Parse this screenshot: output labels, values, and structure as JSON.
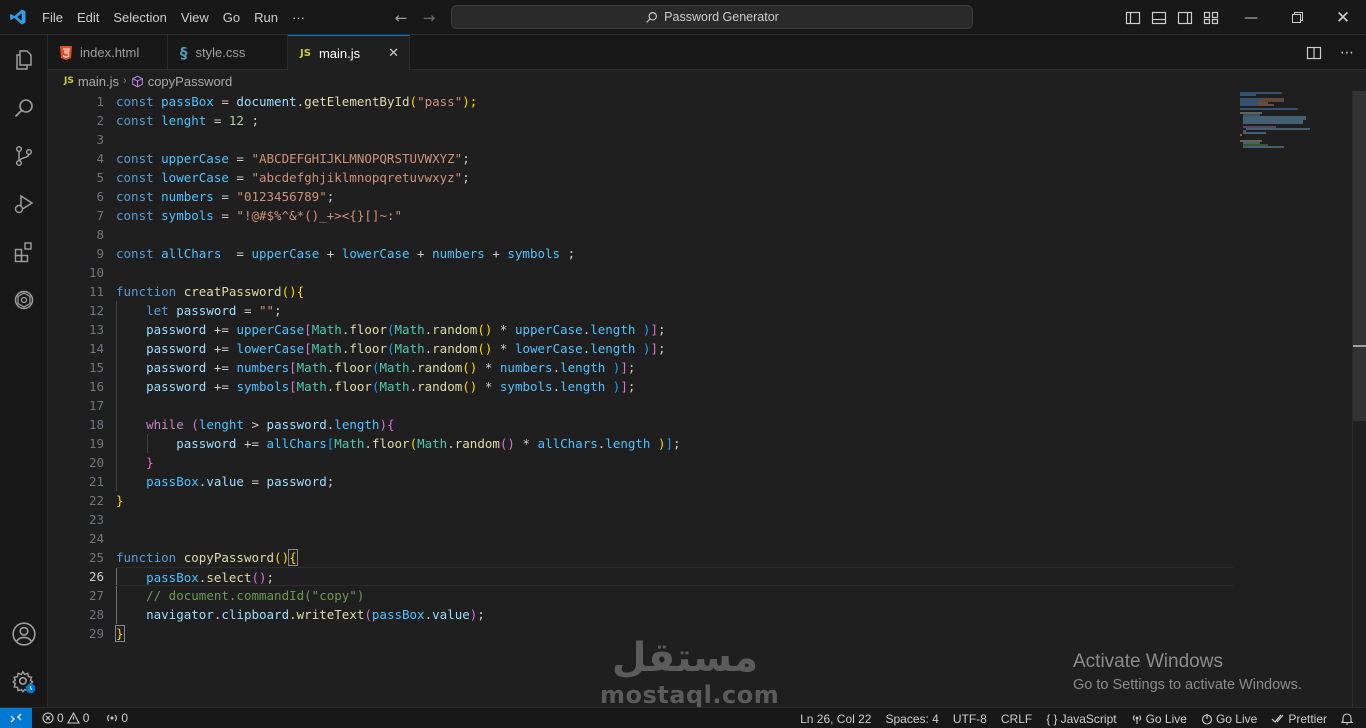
{
  "menu": [
    "File",
    "Edit",
    "Selection",
    "View",
    "Go",
    "Run",
    "···"
  ],
  "command_center": "Password Generator",
  "tabs": [
    {
      "label": "index.html",
      "icon": "html5-icon"
    },
    {
      "label": "style.css",
      "icon": "css-icon"
    },
    {
      "label": "main.js",
      "icon": "js-icon",
      "active": true
    }
  ],
  "js_badge": "JS",
  "breadcrumb": {
    "file": "main.js",
    "symbol": "copyPassword"
  },
  "line_numbers": [
    "1",
    "2",
    "3",
    "4",
    "5",
    "6",
    "7",
    "8",
    "9",
    "10",
    "11",
    "12",
    "13",
    "14",
    "15",
    "16",
    "17",
    "18",
    "19",
    "20",
    "21",
    "22",
    "23",
    "24",
    "25",
    "26",
    "27",
    "28",
    "29"
  ],
  "current_line": 26,
  "code": {
    "l1": [
      "const ",
      "passBox",
      " = ",
      "document",
      ".",
      "getElementById",
      "(",
      "\"pass\"",
      ");"
    ],
    "l2": [
      "const ",
      "lenght",
      " = ",
      "12",
      " ;"
    ],
    "l4": [
      "const ",
      "upperCase",
      " = ",
      "\"ABCDEFGHIJKLMNOPQRSTUVWXYZ\"",
      ";"
    ],
    "l5": [
      "const ",
      "lowerCase",
      " = ",
      "\"abcdefghjiklmnopqretuvwxyz\"",
      ";"
    ],
    "l6": [
      "const ",
      "numbers",
      " = ",
      "\"0123456789\"",
      ";"
    ],
    "l7": [
      "const ",
      "symbols",
      " = ",
      "\"!@#$%^&*()_+><{}[]~:\""
    ],
    "l9": [
      "const ",
      "allChars",
      "  = ",
      "upperCase",
      " + ",
      "lowerCase",
      " + ",
      "numbers",
      " + ",
      "symbols",
      " ;"
    ],
    "l11": [
      "function ",
      "creatPassword",
      "(){"
    ],
    "l12": [
      "    ",
      "let ",
      "password",
      " = ",
      "\"\"",
      ";"
    ],
    "l13": [
      "    ",
      "password",
      " += ",
      "upperCase",
      "[",
      "Math",
      ".",
      "floor",
      "(",
      "Math",
      ".",
      "random",
      "()",
      " * ",
      "upperCase",
      ".",
      "length",
      " )",
      "]",
      ";"
    ],
    "l14": [
      "    ",
      "password",
      " += ",
      "lowerCase",
      "[",
      "Math",
      ".",
      "floor",
      "(",
      "Math",
      ".",
      "random",
      "()",
      " * ",
      "lowerCase",
      ".",
      "length",
      " )",
      "]",
      ";"
    ],
    "l15": [
      "    ",
      "password",
      " += ",
      "numbers",
      "[",
      "Math",
      ".",
      "floor",
      "(",
      "Math",
      ".",
      "random",
      "()",
      " * ",
      "numbers",
      ".",
      "length",
      " )",
      "]",
      ";"
    ],
    "l16": [
      "    ",
      "password",
      " += ",
      "symbols",
      "[",
      "Math",
      ".",
      "floor",
      "(",
      "Math",
      ".",
      "random",
      "()",
      " * ",
      "symbols",
      ".",
      "length",
      " )",
      "]",
      ";"
    ],
    "l18": [
      "    ",
      "while",
      " (",
      "lenght",
      " > ",
      "password",
      ".",
      "length",
      "){"
    ],
    "l19": [
      "        ",
      "password",
      " += ",
      "allChars",
      "[",
      "Math",
      ".",
      "floor",
      "(",
      "Math",
      ".",
      "random",
      "()",
      " * ",
      "allChars",
      ".",
      "length",
      " )",
      "]",
      ";"
    ],
    "l20": [
      "    ",
      "}"
    ],
    "l21": [
      "    ",
      "passBox",
      ".",
      "value",
      " = ",
      "password",
      ";"
    ],
    "l22": [
      "}"
    ],
    "l25": [
      "function ",
      "copyPassword",
      "()",
      "{"
    ],
    "l26": [
      "    ",
      "passBox",
      ".",
      "select",
      "()",
      ";"
    ],
    "l27": [
      "    ",
      "// document.commandId(\"copy\")"
    ],
    "l28": [
      "    ",
      "navigator",
      ".",
      "clipboard",
      ".",
      "writeText",
      "(",
      "passBox",
      ".",
      "value",
      ")",
      ";"
    ],
    "l29": [
      "}"
    ]
  },
  "watermark": {
    "activate_title": "Activate Windows",
    "activate_sub": "Go to Settings to activate Windows.",
    "brand_ar": "مستقل",
    "brand_en": "mostaql.com"
  },
  "status": {
    "errors": "0",
    "warnings": "0",
    "ports": "0",
    "position": "Ln 26, Col 22",
    "spaces": "Spaces: 4",
    "encoding": "UTF-8",
    "eol": "CRLF",
    "language": "JavaScript",
    "golive1": "Go Live",
    "golive2": "Go Live",
    "prettier": "Prettier"
  },
  "colors": {
    "accent": "#0078d4",
    "editor_bg": "#1f1f1f",
    "chrome_bg": "#181818"
  }
}
